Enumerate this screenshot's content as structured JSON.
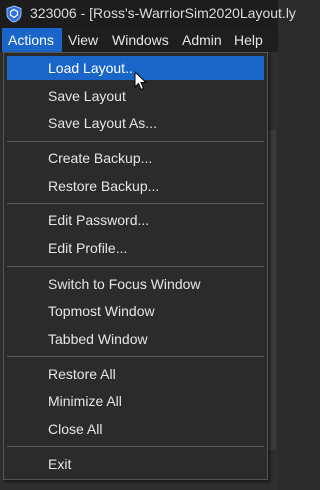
{
  "window": {
    "title": "323006 - [Ross's-WarriorSim2020Layout.ly"
  },
  "menubar": {
    "items": [
      {
        "label": "Actions",
        "active": true
      },
      {
        "label": "View"
      },
      {
        "label": "Windows"
      },
      {
        "label": "Admin"
      },
      {
        "label": "Help"
      }
    ]
  },
  "actions_menu": {
    "items": [
      {
        "label": "Load Layout...",
        "highlighted": true
      },
      {
        "label": "Save Layout"
      },
      {
        "label": "Save Layout As..."
      },
      {
        "label": "Create Backup..."
      },
      {
        "label": "Restore Backup..."
      },
      {
        "label": "Edit Password..."
      },
      {
        "label": "Edit Profile..."
      },
      {
        "label": "Switch to Focus Window"
      },
      {
        "label": "Topmost Window"
      },
      {
        "label": "Tabbed Window"
      },
      {
        "label": "Restore All"
      },
      {
        "label": "Minimize All"
      },
      {
        "label": "Close All"
      },
      {
        "label": "Exit"
      }
    ]
  },
  "colors": {
    "accent": "#1a66c8",
    "menu_bg": "#2b2b2b",
    "titlebar_bg": "#1c1c1c"
  },
  "icons": {
    "app": "shield-logo-icon",
    "cursor": "mouse-pointer-icon"
  }
}
